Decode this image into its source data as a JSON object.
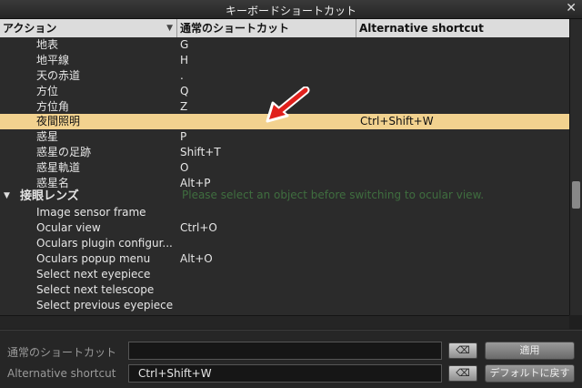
{
  "window": {
    "title": "キーボードショートカット",
    "close_glyph": "✕"
  },
  "columns": {
    "action": "アクション",
    "primary": "通常のショートカット",
    "alternative": "Alternative shortcut"
  },
  "rows": [
    {
      "action": "地表",
      "primary": "G",
      "alt": ""
    },
    {
      "action": "地平線",
      "primary": "H",
      "alt": ""
    },
    {
      "action": "天の赤道",
      "primary": ".",
      "alt": ""
    },
    {
      "action": "方位",
      "primary": "Q",
      "alt": ""
    },
    {
      "action": "方位角",
      "primary": "Z",
      "alt": ""
    },
    {
      "action": "夜間照明",
      "primary": "",
      "alt": "Ctrl+Shift+W"
    },
    {
      "action": "惑星",
      "primary": "P",
      "alt": ""
    },
    {
      "action": "惑星の足跡",
      "primary": "Shift+T",
      "alt": ""
    },
    {
      "action": "惑星軌道",
      "primary": "O",
      "alt": ""
    },
    {
      "action": "惑星名",
      "primary": "Alt+P",
      "alt": ""
    },
    {
      "group": "接眼レンズ",
      "toggle": "▼"
    },
    {
      "action": "Image sensor frame",
      "primary": "",
      "alt": ""
    },
    {
      "action": "Ocular view",
      "primary": "Ctrl+O",
      "alt": ""
    },
    {
      "action": "Oculars plugin configur...",
      "primary": "",
      "alt": ""
    },
    {
      "action": "Oculars popup menu",
      "primary": "Alt+O",
      "alt": ""
    },
    {
      "action": "Select next eyepiece",
      "primary": "",
      "alt": ""
    },
    {
      "action": "Select next telescope",
      "primary": "",
      "alt": ""
    },
    {
      "action": "Select previous eyepiece",
      "primary": "",
      "alt": ""
    }
  ],
  "selected_index": 5,
  "overlay_hint": "Please select an object before switching to ocular view.",
  "editor": {
    "primary_label": "通常のショートカット",
    "primary_value": "",
    "alt_label": "Alternative shortcut",
    "alt_value": "Ctrl+Shift+W",
    "clear_glyph": "⌫",
    "apply_label": "適用",
    "default_label": "デフォルトに戻す"
  },
  "colors": {
    "selection": "#f2d28f",
    "annotation_arrow": "#e0201c"
  }
}
